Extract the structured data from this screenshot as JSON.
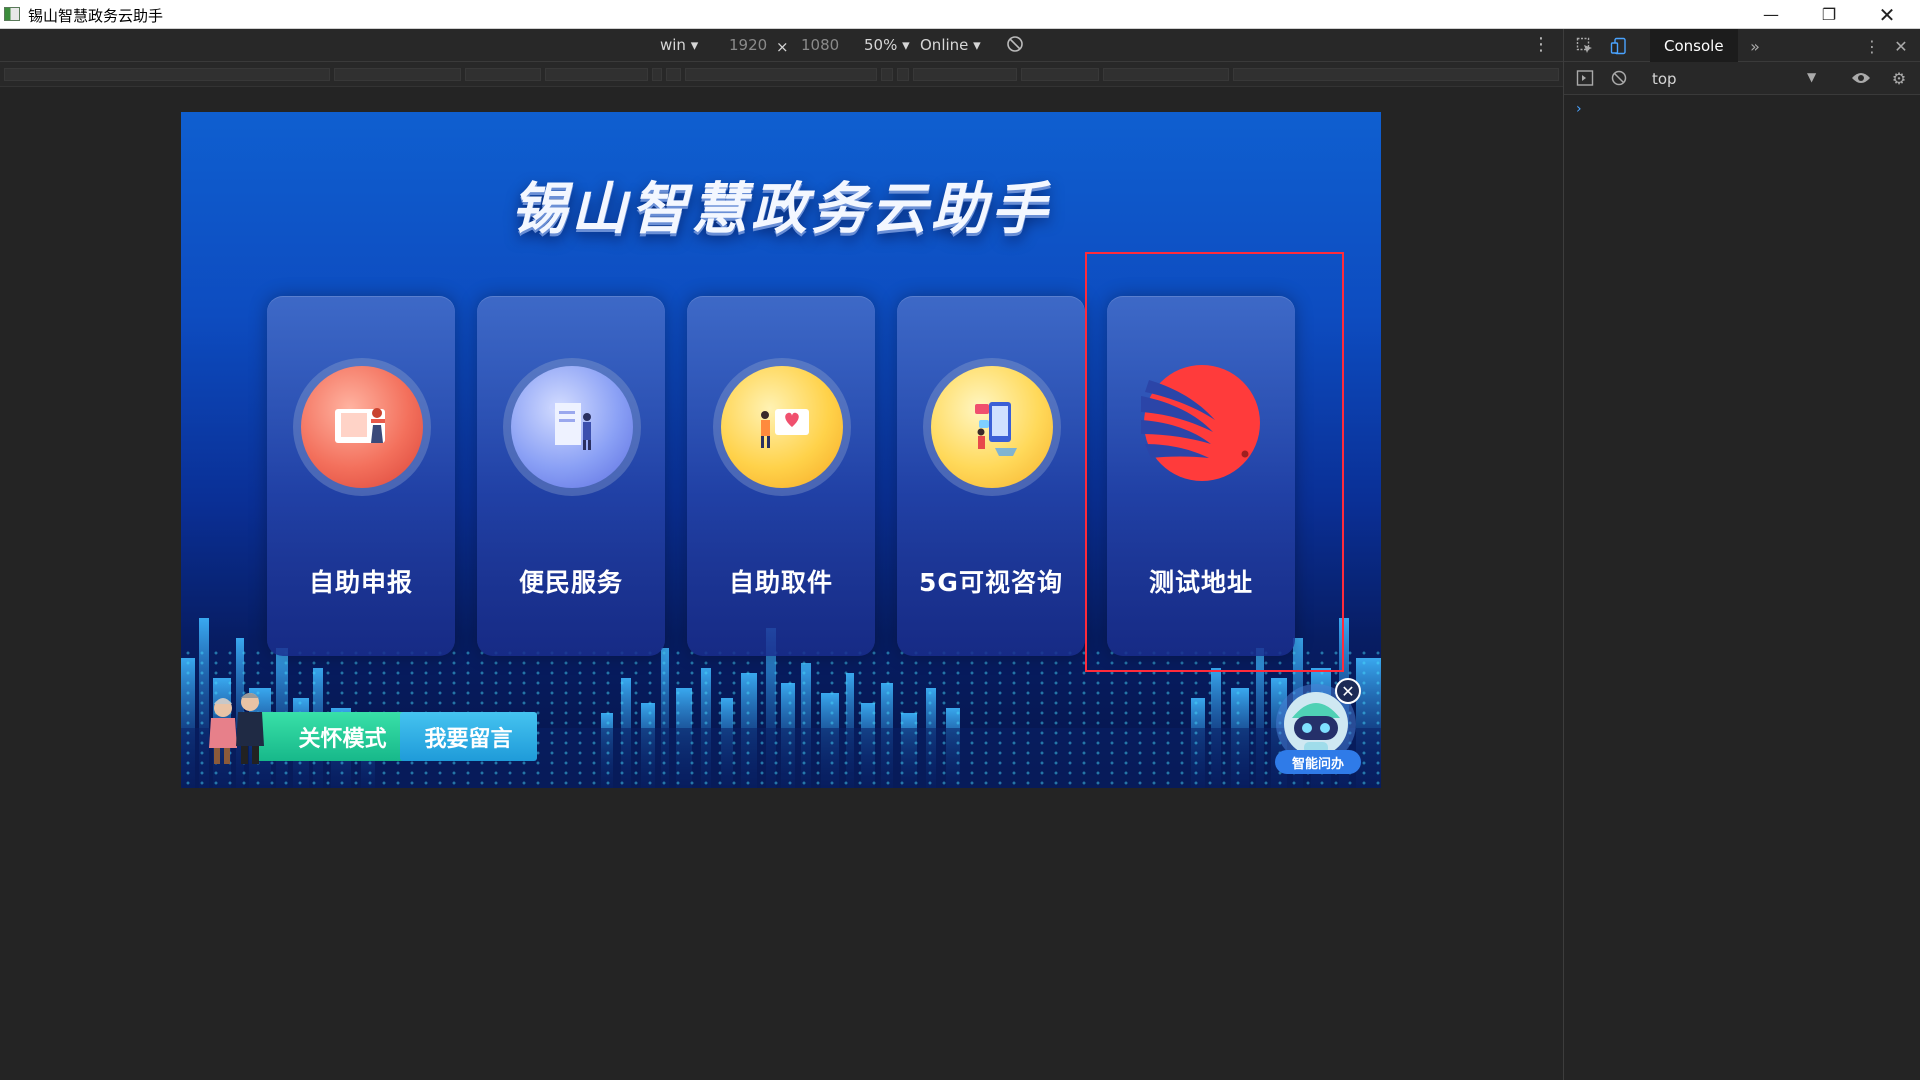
{
  "window": {
    "title": "锡山智慧政务云助手"
  },
  "device_toolbar": {
    "device": "win",
    "width": "1920",
    "height": "1080",
    "times": "×",
    "zoom": "50%",
    "throttle": "Online"
  },
  "devtools": {
    "tab": "Console",
    "context": "top",
    "prompt": "›"
  },
  "page": {
    "title": "锡山智慧政务云助手",
    "cards": [
      {
        "label": "自助申报",
        "icon": "self-declare-icon"
      },
      {
        "label": "便民服务",
        "icon": "convenience-service-icon"
      },
      {
        "label": "自助取件",
        "icon": "self-pickup-icon"
      },
      {
        "label": "5G可视咨询",
        "icon": "video-consult-icon"
      },
      {
        "label": "测试地址",
        "icon": "test-logo-icon"
      }
    ],
    "care_mode": "关怀模式",
    "leave_message": "我要留言",
    "assistant_label": "智能问办"
  },
  "colors": {
    "highlight": "#ff2b3b",
    "care_button": "#17b88a",
    "message_button": "#1f9bd9",
    "logo_red": "#ff3b3b"
  }
}
